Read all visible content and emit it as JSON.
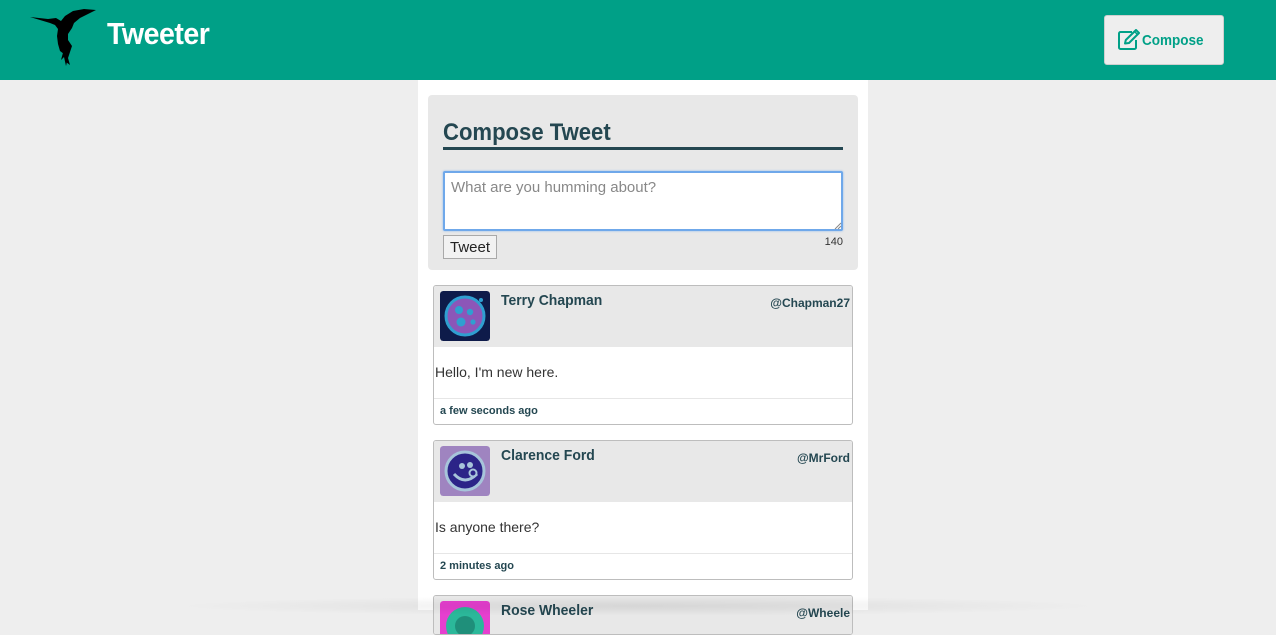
{
  "header": {
    "brand": "Tweeter",
    "logo_icon": "hummingbird-icon",
    "compose_button": {
      "label": "Compose",
      "icon": "edit-icon"
    }
  },
  "colors": {
    "brand": "#00a087",
    "page_background": "#eeeeee",
    "heading": "#244751",
    "panel": "#e8e8e8"
  },
  "compose": {
    "title": "Compose Tweet",
    "placeholder": "What are you humming about?",
    "value": "",
    "submit_label": "Tweet",
    "char_counter": "140"
  },
  "tweets": [
    {
      "name": "Terry Chapman",
      "handle": "@Chapman27",
      "text": "Hello, I'm new here.",
      "time": "a few seconds ago",
      "avatar_icon": "avatar-icon"
    },
    {
      "name": "Clarence Ford",
      "handle": "@MrFord",
      "text": "Is anyone there?",
      "time": "2 minutes ago",
      "avatar_icon": "avatar-icon"
    },
    {
      "name": "Rose Wheeler",
      "handle": "@Wheele",
      "text": "",
      "time": "",
      "avatar_icon": "avatar-icon"
    }
  ]
}
